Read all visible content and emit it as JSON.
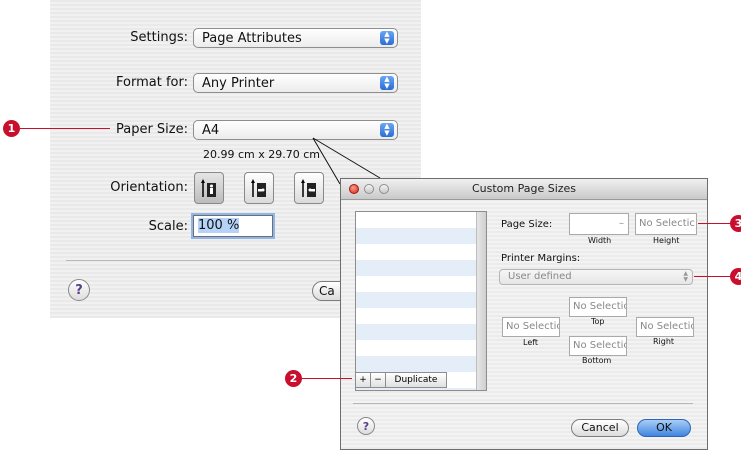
{
  "page_setup": {
    "settings_label": "Settings:",
    "settings_value": "Page Attributes",
    "format_label": "Format for:",
    "format_value": "Any Printer",
    "paper_label": "Paper Size:",
    "paper_value": "A4",
    "paper_dims": "20.99 cm x 29.70 cm",
    "orientation_label": "Orientation:",
    "scale_label": "Scale:",
    "scale_value": "100 %",
    "help_label": "?",
    "cancel_partial": "Ca"
  },
  "custom_sizes": {
    "title": "Custom Page Sizes",
    "page_size_label": "Page Size:",
    "width_value": "",
    "width_separator": "–",
    "height_value": "No Selectic",
    "width_label": "Width",
    "height_label": "Height",
    "margins_label": "Printer Margins:",
    "margins_value": "User defined",
    "top_value": "No Selectic",
    "top_label": "Top",
    "left_value": "No Selectic",
    "left_label": "Left",
    "right_value": "No Selectic",
    "right_label": "Right",
    "bottom_value": "No Selectic",
    "bottom_label": "Bottom",
    "plus_label": "+",
    "minus_label": "−",
    "duplicate_label": "Duplicate",
    "help_label": "?",
    "cancel_label": "Cancel",
    "ok_label": "OK"
  },
  "callouts": [
    "1",
    "2",
    "3",
    "4"
  ],
  "colors": {
    "callout": "#c8102e",
    "ok_button": "#4a8ee6"
  }
}
